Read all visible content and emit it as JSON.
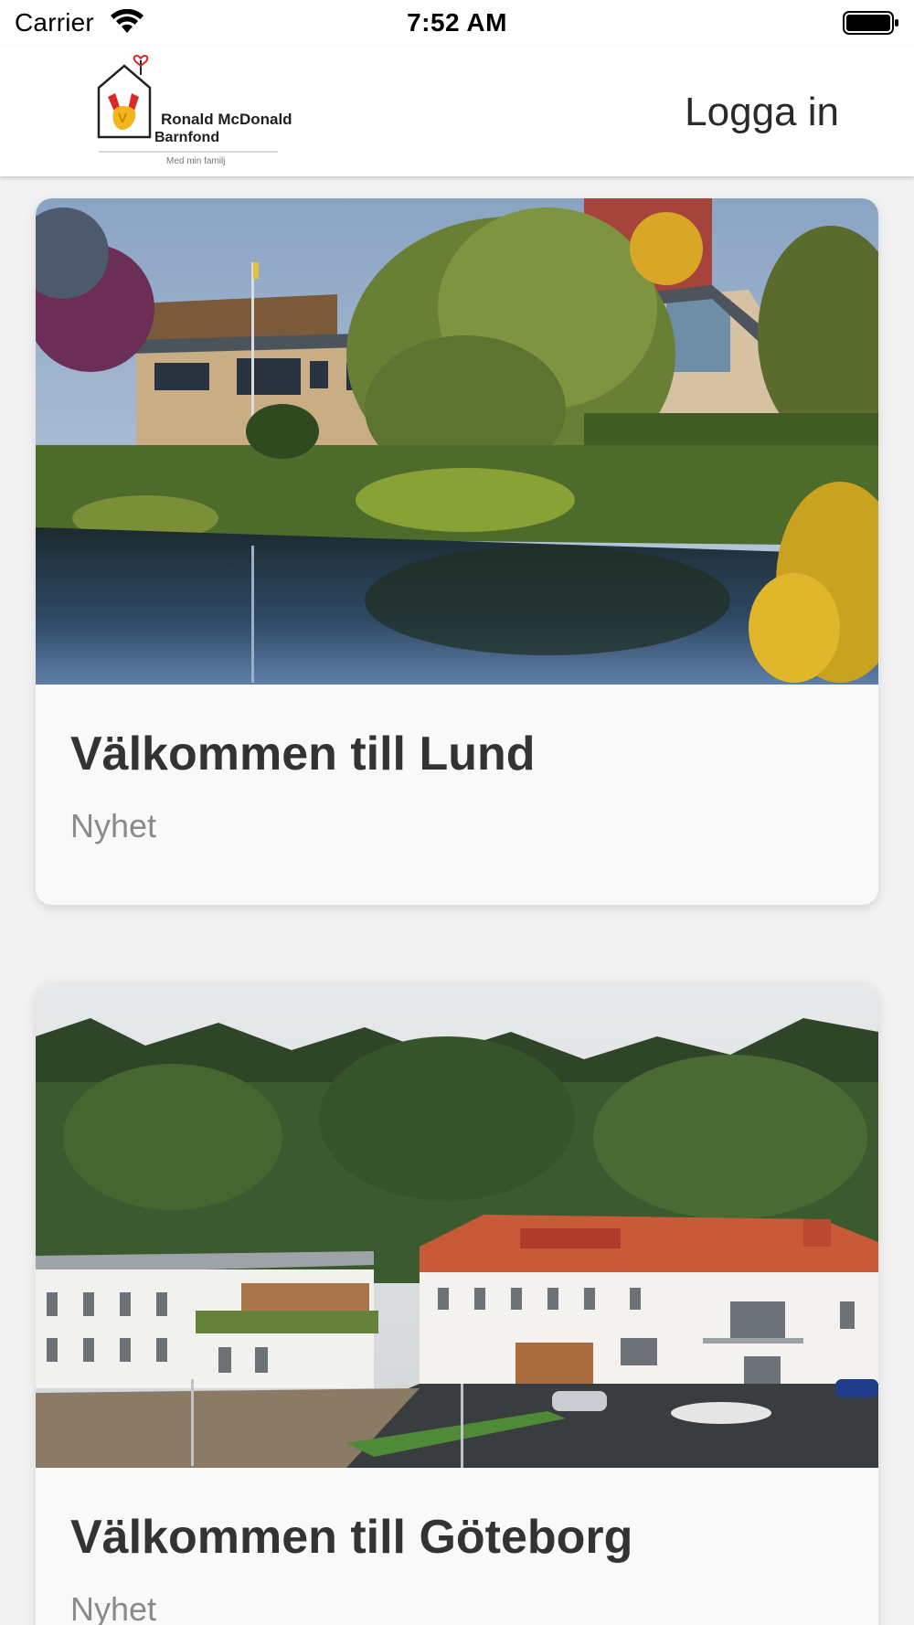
{
  "status_bar": {
    "carrier": "Carrier",
    "time": "7:52 AM",
    "wifi_icon": "wifi-icon",
    "battery_icon": "battery-icon"
  },
  "header": {
    "logo": {
      "line1": "Ronald McDonald",
      "line2": "Barnfond",
      "tagline": "Med min familj"
    },
    "login_label": "Logga in"
  },
  "feed": {
    "items": [
      {
        "title": "Välkommen till Lund",
        "category": "Nyhet",
        "image": "lund-house-pond-photo"
      },
      {
        "title": "Välkommen till Göteborg",
        "category": "Nyhet",
        "image": "goteborg-house-forest-photo"
      }
    ]
  },
  "colors": {
    "background": "#f2f2f2",
    "card": "#f9f9f9",
    "title": "#333333",
    "subtitle": "#8a8a8a"
  }
}
